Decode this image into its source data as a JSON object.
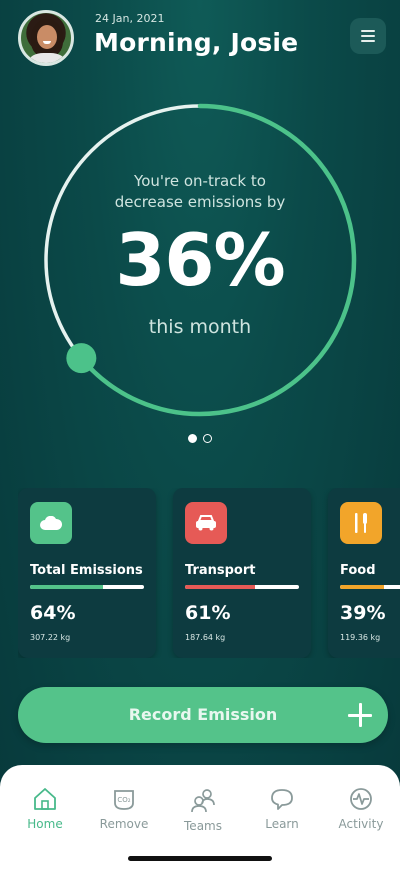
{
  "header": {
    "date": "24 Jan, 2021",
    "greeting": "Morning, Josie",
    "menu_icon": "hamburger-menu-icon"
  },
  "progress": {
    "line1": "You're on-track to",
    "line2": "decrease emissions by",
    "percent": "36%",
    "period": "this month",
    "ring_fraction": 0.36,
    "ring_color": "#4cc28a"
  },
  "pager": {
    "pages": 2,
    "active": 0
  },
  "cards": [
    {
      "title": "Total Emissions",
      "percent": "64%",
      "amount": "307.22 kg",
      "fraction": 0.64,
      "color": "#54c38a",
      "icon": "cloud-icon"
    },
    {
      "title": "Transport",
      "percent": "61%",
      "amount": "187.64 kg",
      "fraction": 0.61,
      "color": "#e65a56",
      "icon": "car-icon"
    },
    {
      "title": "Food",
      "percent": "39%",
      "amount": "119.36 kg",
      "fraction": 0.39,
      "color": "#f2a52a",
      "icon": "cutlery-icon"
    }
  ],
  "record": {
    "label": "Record Emission",
    "icon": "plus-icon"
  },
  "tabs": [
    {
      "label": "Home",
      "icon": "home-icon",
      "active": true
    },
    {
      "label": "Remove",
      "icon": "remove-co2-icon",
      "active": false
    },
    {
      "label": "Teams",
      "icon": "teams-icon",
      "active": false
    },
    {
      "label": "Learn",
      "icon": "chat-bubble-icon",
      "active": false
    },
    {
      "label": "Activity",
      "icon": "activity-pulse-icon",
      "active": false
    }
  ],
  "colors": {
    "background": "#0b4a49",
    "accent": "#54c38a",
    "card": "#0d3b40"
  }
}
